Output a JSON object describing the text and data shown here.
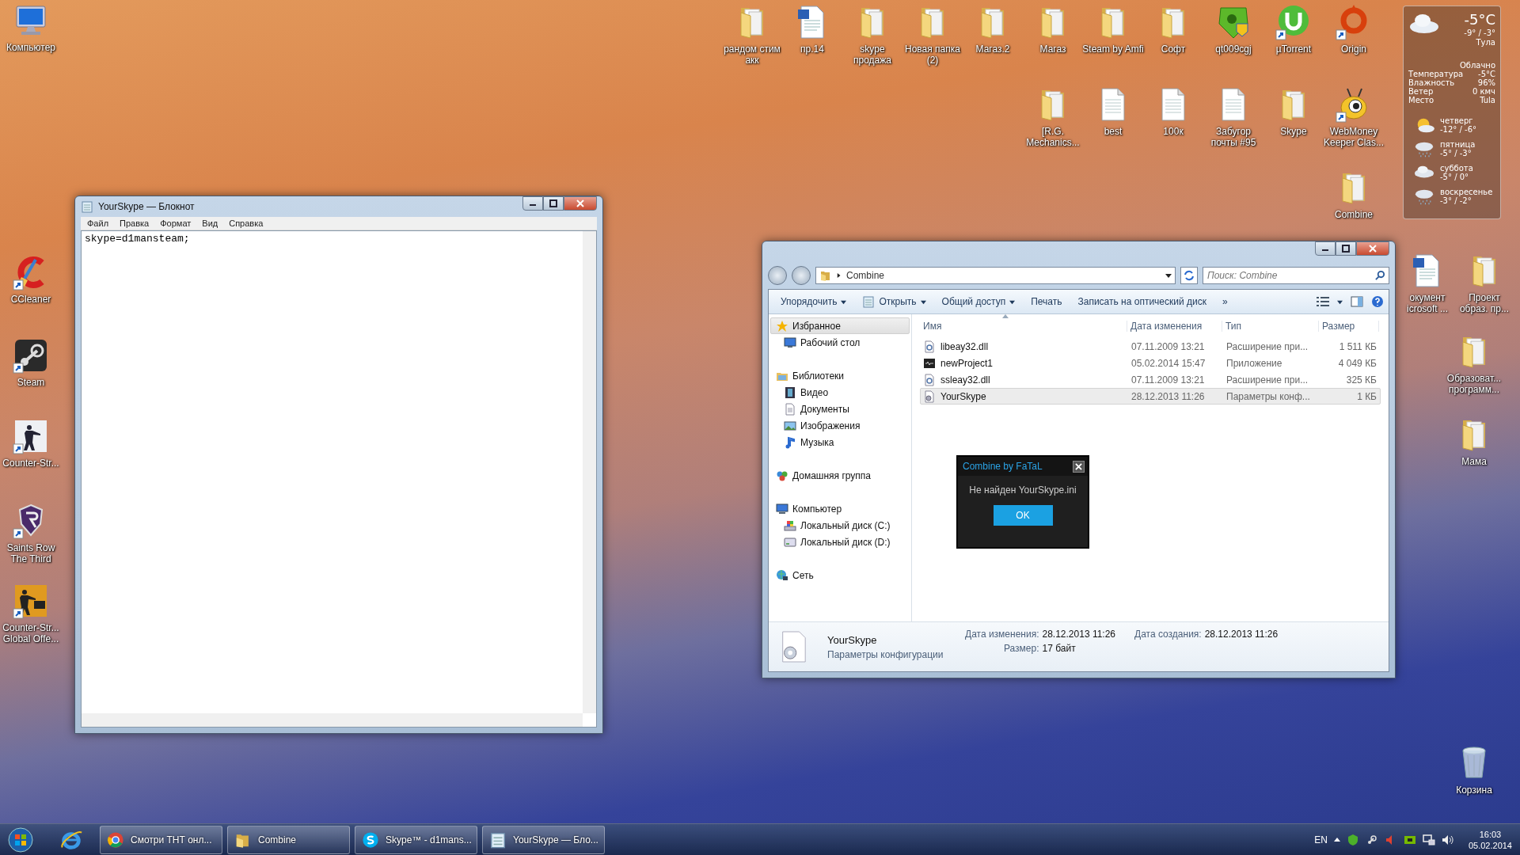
{
  "desktop_icons": [
    {
      "label": "Компьютер",
      "kind": "computer",
      "shortcut": false
    },
    {
      "label": "CCleaner",
      "kind": "ccleaner",
      "shortcut": true
    },
    {
      "label": "Steam",
      "kind": "steam",
      "shortcut": true
    },
    {
      "label": "Counter-Str...",
      "kind": "counter-strike",
      "shortcut": true
    },
    {
      "label": "Saints Row The Third",
      "kind": "saints-row",
      "shortcut": true
    },
    {
      "label": "Counter-Str... Global Offe...",
      "kind": "csgo",
      "shortcut": true
    },
    {
      "label": "рандом стим акк",
      "kind": "folder",
      "shortcut": false
    },
    {
      "label": "пр.14",
      "kind": "word-doc",
      "shortcut": false
    },
    {
      "label": "skype продажа",
      "kind": "folder",
      "shortcut": false
    },
    {
      "label": "Новая папка (2)",
      "kind": "folder",
      "shortcut": false
    },
    {
      "label": "Магаз.2",
      "kind": "folder",
      "shortcut": false
    },
    {
      "label": "Магаз",
      "kind": "folder",
      "shortcut": false
    },
    {
      "label": "Steam by Amfi",
      "kind": "folder",
      "shortcut": false
    },
    {
      "label": "Софт",
      "kind": "folder",
      "shortcut": false
    },
    {
      "label": "qt009cgj",
      "kind": "antivirus",
      "shortcut": false
    },
    {
      "label": "µTorrent",
      "kind": "utorrent",
      "shortcut": true
    },
    {
      "label": "Origin",
      "kind": "origin",
      "shortcut": true
    },
    {
      "label": "[R.G. Mechanics...",
      "kind": "folder",
      "shortcut": false
    },
    {
      "label": "best",
      "kind": "text-file",
      "shortcut": false
    },
    {
      "label": "100к",
      "kind": "text-file",
      "shortcut": false
    },
    {
      "label": "Забугор почты #95",
      "kind": "text-file",
      "shortcut": false
    },
    {
      "label": "Skype",
      "kind": "folder",
      "shortcut": false
    },
    {
      "label": "WebMoney Keeper Clas...",
      "kind": "webmoney",
      "shortcut": true
    },
    {
      "label": "Combine",
      "kind": "folder",
      "shortcut": false
    },
    {
      "label": "окумент icrosoft ...",
      "kind": "word-doc",
      "shortcut": false
    },
    {
      "label": "Проект образ. пр...",
      "kind": "folder",
      "shortcut": false
    },
    {
      "label": "Образоват... программ...",
      "kind": "folder",
      "shortcut": false
    },
    {
      "label": "Мама",
      "kind": "folder",
      "shortcut": false
    },
    {
      "label": "Корзина",
      "kind": "recycle-bin",
      "shortcut": false
    }
  ],
  "weather": {
    "temperature": "-5°C",
    "range": "-9° / -3°",
    "city": "Тула",
    "condition": "Облачно",
    "details": [
      {
        "label": "Температура",
        "value": "-5°C"
      },
      {
        "label": "Влажность",
        "value": "96%"
      },
      {
        "label": "Ветер",
        "value": "0 кмч"
      },
      {
        "label": "Место",
        "value": "Tula"
      }
    ],
    "forecast": [
      {
        "day": "четверг",
        "range": "-12° / -6°",
        "kind": "sun-cloud"
      },
      {
        "day": "пятница",
        "range": "-5° / -3°",
        "kind": "snow"
      },
      {
        "day": "суббота",
        "range": "-5° / 0°",
        "kind": "cloud"
      },
      {
        "day": "воскресенье",
        "range": "-3° / -2°",
        "kind": "snow"
      }
    ]
  },
  "notepad": {
    "title": "YourSkype — Блокнот",
    "menu": [
      "Файл",
      "Правка",
      "Формат",
      "Вид",
      "Справка"
    ],
    "text": "skype=d1mansteam;"
  },
  "explorer": {
    "address": "Combine",
    "search": {
      "placeholder": "Поиск: Combine"
    },
    "toolbar": [
      {
        "label": "Упорядочить",
        "dropdown": true
      },
      {
        "label": "Открыть",
        "dropdown": true
      },
      {
        "label": "Общий доступ",
        "dropdown": true
      },
      {
        "label": "Печать",
        "dropdown": false
      },
      {
        "label": "Записать на оптический диск",
        "dropdown": false
      }
    ],
    "toolbar_more": "»",
    "nav": [
      {
        "label": "Избранное",
        "kind": "star",
        "selected": true,
        "children": [
          {
            "label": "Рабочий стол",
            "kind": "desktop",
            "selected": false
          }
        ]
      },
      {
        "label": "Библиотеки",
        "kind": "library",
        "selected": false,
        "children": [
          {
            "label": "Видео",
            "kind": "film",
            "selected": false
          },
          {
            "label": "Документы",
            "kind": "document",
            "selected": false
          },
          {
            "label": "Изображения",
            "kind": "picture",
            "selected": false
          },
          {
            "label": "Музыка",
            "kind": "music",
            "selected": false
          }
        ]
      },
      {
        "label": "Домашняя группа",
        "kind": "homegroup",
        "selected": false
      },
      {
        "label": "Компьютер",
        "kind": "computer",
        "selected": false,
        "children": [
          {
            "label": "Локальный диск (C:)",
            "kind": "system-drive",
            "selected": false
          },
          {
            "label": "Локальный диск (D:)",
            "kind": "drive",
            "selected": false
          }
        ]
      },
      {
        "label": "Сеть",
        "kind": "network",
        "selected": false
      }
    ],
    "columns": [
      "Имя",
      "Дата изменения",
      "Тип",
      "Размер"
    ],
    "files": [
      {
        "name": "libeay32.dll",
        "date": "07.11.2009 13:21",
        "type": "Расширение при...",
        "size": "1 511 КБ",
        "kind": "dll",
        "selected": false
      },
      {
        "name": "newProject1",
        "date": "05.02.2014 15:47",
        "type": "Приложение",
        "size": "4 049 КБ",
        "kind": "app",
        "selected": false
      },
      {
        "name": "ssleay32.dll",
        "date": "07.11.2009 13:21",
        "type": "Расширение при...",
        "size": "325 КБ",
        "kind": "dll",
        "selected": false
      },
      {
        "name": "YourSkype",
        "date": "28.12.2013 11:26",
        "type": "Параметры конф...",
        "size": "1 КБ",
        "kind": "ini",
        "selected": true
      }
    ],
    "details": {
      "name": "YourSkype",
      "type": "Параметры конфигурации",
      "fields": [
        {
          "label": "Дата изменения:",
          "value": "28.12.2013 11:26"
        },
        {
          "label": "Размер:",
          "value": "17 байт"
        },
        {
          "label": "Дата создания:",
          "value": "28.12.2013 11:26"
        }
      ]
    }
  },
  "dialog": {
    "title": "Combine by FaTaL",
    "message": "Не найден YourSkype.ini",
    "button": "OK"
  },
  "taskbar": {
    "items": [
      {
        "label": "Смотри ТНТ онл...",
        "kind": "chrome"
      },
      {
        "label": "Combine",
        "kind": "folder"
      },
      {
        "label": "Skype™ - d1mans...",
        "kind": "skype"
      },
      {
        "label": "YourSkype — Бло...",
        "kind": "notepad"
      }
    ],
    "language": "EN",
    "time": "16:03",
    "date": "05.02.2014"
  }
}
